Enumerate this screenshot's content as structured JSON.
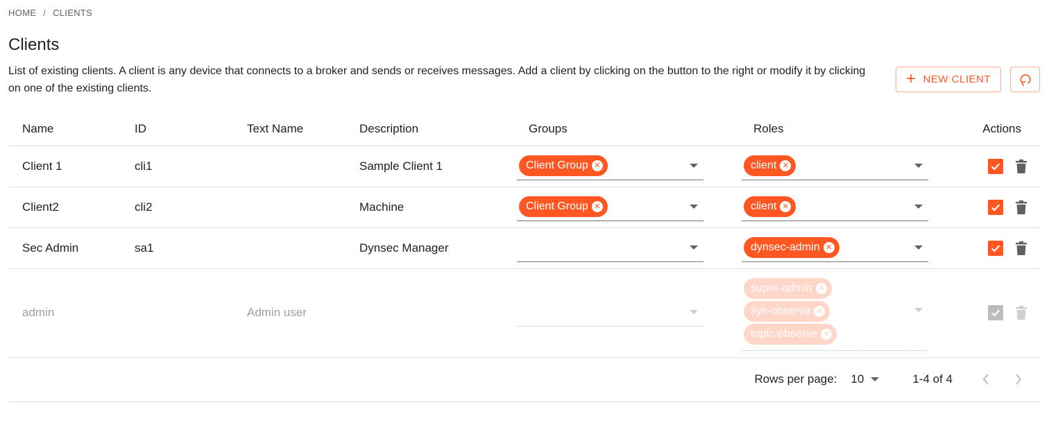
{
  "breadcrumb": {
    "home": "HOME",
    "separator": "/",
    "current": "CLIENTS"
  },
  "page": {
    "title": "Clients",
    "description": "List of existing clients. A client is any device that connects to a broker and sends or receives messages. Add a client by clicking on the button to the right or modify it by clicking on one of the existing clients."
  },
  "toolbar": {
    "new_client_label": "NEW CLIENT",
    "new_client_icon": "plus-icon",
    "refresh_icon": "refresh-icon"
  },
  "table": {
    "columns": [
      "Name",
      "ID",
      "Text Name",
      "Description",
      "Groups",
      "Roles",
      "Actions"
    ],
    "rows": [
      {
        "name": "Client 1",
        "id": "cli1",
        "text_name": "",
        "description": "Sample Client 1",
        "groups": [
          "Client Group"
        ],
        "roles": [
          "client"
        ],
        "disabled": false
      },
      {
        "name": "Client2",
        "id": "cli2",
        "text_name": "",
        "description": "Machine",
        "groups": [
          "Client Group"
        ],
        "roles": [
          "client"
        ],
        "disabled": false
      },
      {
        "name": "Sec Admin",
        "id": "sa1",
        "text_name": "",
        "description": "Dynsec Manager",
        "groups": [],
        "roles": [
          "dynsec-admin"
        ],
        "disabled": false
      },
      {
        "name": "admin",
        "id": "",
        "text_name": "Admin user",
        "description": "",
        "groups": [],
        "roles": [
          "super-admin",
          "sys-observe",
          "topic-observe"
        ],
        "disabled": true
      }
    ]
  },
  "pagination": {
    "rows_per_page_label": "Rows per page:",
    "rows_per_page": "10",
    "range": "1-4 of 4"
  },
  "colors": {
    "accent": "#ff5722",
    "accent_disabled": "#ffd6c8"
  }
}
